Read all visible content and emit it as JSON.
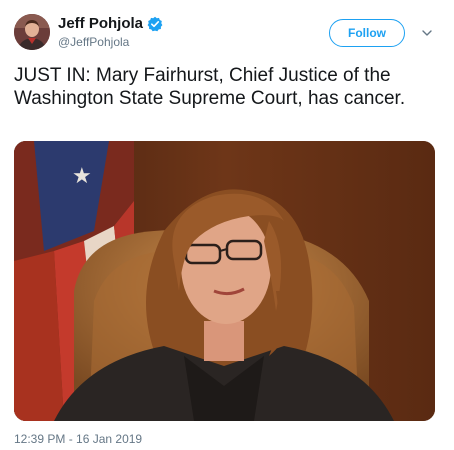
{
  "author": {
    "display_name": "Jeff Pohjola",
    "handle": "@JeffPohjola",
    "verified": true,
    "avatar_icon": "profile-photo"
  },
  "actions": {
    "follow_label": "Follow",
    "more_icon": "chevron-down-icon"
  },
  "tweet": {
    "text": "JUST IN: Mary Fairhurst, Chief Justice of the Washington State Supreme Court, has cancer.",
    "timestamp": "12:39 PM - 16 Jan 2019"
  },
  "colors": {
    "accent": "#1da1f2",
    "text": "#14171a",
    "secondary": "#657786"
  }
}
